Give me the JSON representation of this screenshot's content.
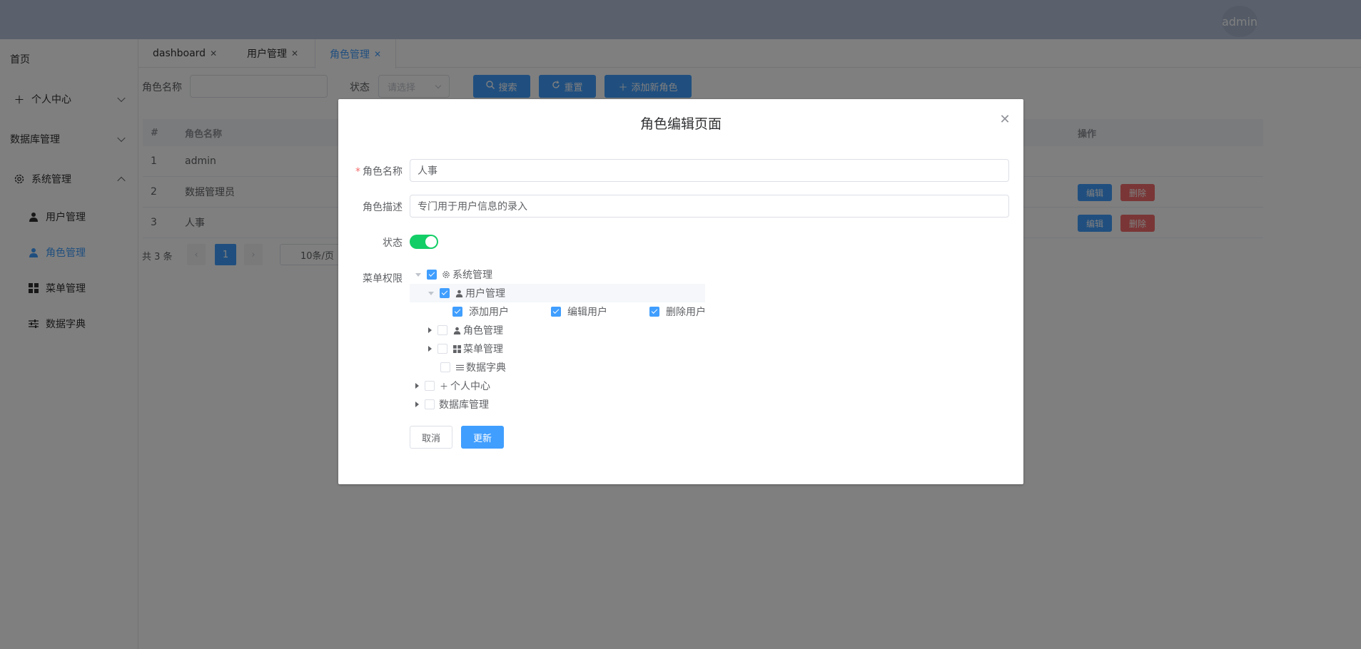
{
  "header": {
    "user": "admin"
  },
  "sidebar": {
    "home": "首页",
    "personal": "个人中心",
    "database": "数据库管理",
    "system": "系统管理",
    "sub_items": [
      {
        "label": "用户管理",
        "icon": "user-icon"
      },
      {
        "label": "角色管理",
        "icon": "user-icon"
      },
      {
        "label": "菜单管理",
        "icon": "grid-icon"
      },
      {
        "label": "数据字典",
        "icon": "sliders-icon"
      }
    ]
  },
  "tabs": [
    {
      "label": "dashboard"
    },
    {
      "label": "用户管理"
    },
    {
      "label": "角色管理"
    }
  ],
  "search": {
    "role_name_label": "角色名称",
    "role_name_value": "",
    "status_label": "状态",
    "status_placeholder": "请选择",
    "search_btn": "搜索",
    "reset_btn": "重置",
    "add_btn": "添加新角色"
  },
  "table": {
    "headers": {
      "index": "#",
      "name": "角色名称",
      "action": "操作"
    },
    "rows": [
      {
        "index": "1",
        "name": "admin"
      },
      {
        "index": "2",
        "name": "数据管理员"
      },
      {
        "index": "3",
        "name": "人事"
      }
    ],
    "edit_label": "编辑",
    "delete_label": "删除"
  },
  "pagination": {
    "total": "共 3 条",
    "current": "1",
    "page_size": "10条/页"
  },
  "dialog": {
    "title": "角色编辑页面",
    "name_label": "角色名称",
    "name_value": "人事",
    "desc_label": "角色描述",
    "desc_value": "专门用于用户信息的录入",
    "status_label": "状态",
    "status_on": true,
    "perm_label": "菜单权限",
    "cancel": "取消",
    "update": "更新"
  },
  "tree": {
    "system": "系统管理",
    "user_mgmt": "用户管理",
    "add_user": "添加用户",
    "edit_user": "编辑用户",
    "delete_user": "删除用户",
    "role_mgmt": "角色管理",
    "menu_mgmt": "菜单管理",
    "dict": "数据字典",
    "personal": "个人中心",
    "database": "数据库管理"
  },
  "colors": {
    "primary": "#409eff",
    "danger": "#f56c6c",
    "success": "#13ce66"
  }
}
